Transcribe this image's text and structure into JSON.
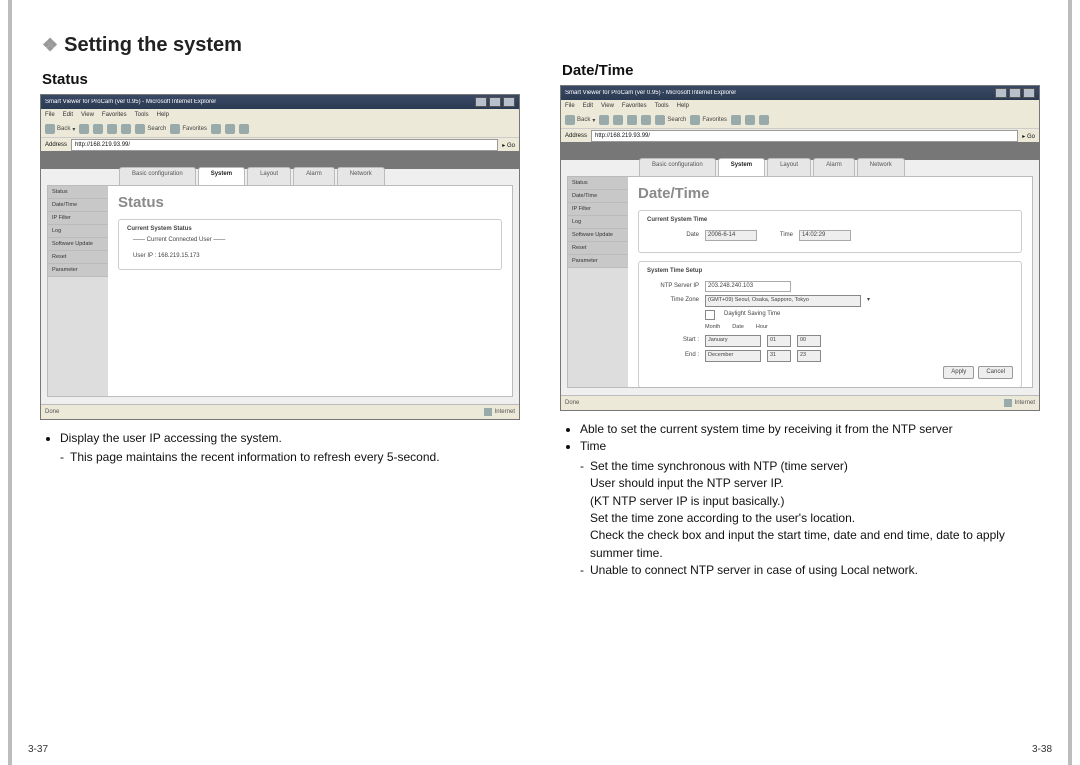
{
  "left": {
    "section_title": "Setting the system",
    "sub_title": "Status",
    "browser_title": "Smart Viewer for ProCam (ver 0.95) - Microsoft Internet Explorer",
    "menus": [
      "File",
      "Edit",
      "View",
      "Favorites",
      "Tools",
      "Help"
    ],
    "toolbar": {
      "back": "Back",
      "search": "Search",
      "favorites": "Favorites"
    },
    "address_label": "Address",
    "address_value": "http://168.219.93.99/",
    "go_label": "Go",
    "tabs": [
      "Basic configuration",
      "System",
      "Layout",
      "Alarm",
      "Network"
    ],
    "active_tab_index": 1,
    "side_items": [
      "Status",
      "Date/Time",
      "IP Filter",
      "Log",
      "Software Update",
      "Reset",
      "Parameter"
    ],
    "main_heading": "Status",
    "panel_title": "Current System Status",
    "panel_line1": "—— Current Connected User ——",
    "panel_line2": "User IP : 168.219.15.173",
    "status_left": "Done",
    "status_right": "Internet",
    "desc": {
      "b1": "Display the user IP accessing the system.",
      "b1a": "This page maintains the recent information to refresh every 5-second."
    },
    "page_num": "3-37"
  },
  "right": {
    "sub_title": "Date/Time",
    "browser_title": "Smart Viewer for ProCam (ver 0.95) - Microsoft Internet Explorer",
    "menus": [
      "File",
      "Edit",
      "View",
      "Favorites",
      "Tools",
      "Help"
    ],
    "toolbar": {
      "back": "Back",
      "search": "Search",
      "favorites": "Favorites"
    },
    "address_label": "Address",
    "address_value": "http://168.219.93.99/",
    "go_label": "Go",
    "tabs": [
      "Basic configuration",
      "System",
      "Layout",
      "Alarm",
      "Network"
    ],
    "active_tab_index": 1,
    "side_items": [
      "Status",
      "Date/Time",
      "IP Filter",
      "Log",
      "Software Update",
      "Reset",
      "Parameter"
    ],
    "main_heading": "Date/Time",
    "panel1_title": "Current System Time",
    "date_label": "Date",
    "date_value": "2006-6-14",
    "time_label": "Time",
    "time_value": "14:02:29",
    "panel2_title": "System Time Setup",
    "ntp_label": "NTP Server IP",
    "ntp_value": "203.248.240.103",
    "tz_label": "Time Zone",
    "tz_value": "(GMT+09) Seoul, Osaka, Sapporo, Tokyo",
    "dst_label": "Daylight Saving Time",
    "cols": {
      "month": "Month",
      "date": "Date",
      "hour": "Hour"
    },
    "start_label": "Start :",
    "start_month": "January",
    "start_date": "01",
    "start_hour": "00",
    "end_label": "End :",
    "end_month": "December",
    "end_date": "31",
    "end_hour": "23",
    "apply": "Apply",
    "cancel": "Cancel",
    "status_left": "Done",
    "status_right": "Internet",
    "desc": {
      "b1": "Able to set the current system time by receiving it from the NTP server",
      "b2": "Time",
      "b2a": "Set the time synchronous with NTP (time server)",
      "b2b": "User should input the NTP server IP.",
      "b2c": "(KT NTP server IP is input basically.)",
      "b2d": "Set the time zone according to the user's location.",
      "b2e": "Check the check box and input the start time, date and end time, date to apply summer time.",
      "b2f": "Unable to connect NTP server in case of using Local network."
    },
    "page_num": "3-38"
  }
}
